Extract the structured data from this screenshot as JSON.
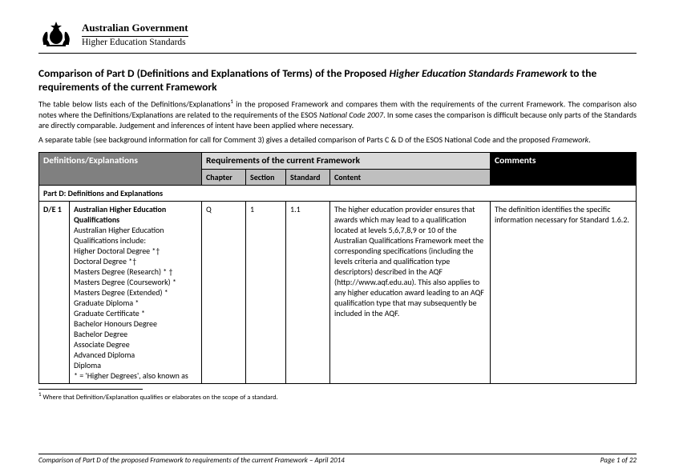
{
  "header": {
    "gov_line": "Australian Government",
    "dept_line": "Higher Education Standards"
  },
  "title": {
    "leading": "Comparison of Part D (Definitions and Explanations of Terms) of the Proposed ",
    "italic": "Higher Education Standards Framework",
    "trailing": " to the requirements of the current Framework"
  },
  "para1": {
    "a": "The table below lists each of the Definitions/Explanations",
    "sup": "1",
    "b": " in the proposed Framework and compares them with the requirements of the current Framework. The comparison also notes where the Definitions/Explanations are related to the requirements of the ESOS ",
    "ital": "National Code 2007",
    "c": ". In some cases the comparison is difficult because only parts of the Standards are directly comparable. Judgement and inferences of intent have been applied where necessary."
  },
  "para2": {
    "a": "A separate table (see background information for call for Comment 3) gives a detailed comparison of Parts C & D of the ESOS National Code and the proposed ",
    "ital": "Framework",
    "b": "."
  },
  "table": {
    "group_headers": {
      "de": "Definitions/Explanations",
      "req": "Requirements of the current Framework",
      "com": "Comments"
    },
    "sub_headers": {
      "chapter": "Chapter",
      "section": "Section",
      "standard": "Standard",
      "content": "Content"
    },
    "part_row": "Part D: Definitions and Explanations",
    "row1": {
      "code": "D/E 1",
      "desc_lead": "Australian Higher Education Qualifications",
      "desc_body": "Australian Higher Education Qualifications include:\nHigher Doctoral Degree *†\nDoctoral Degree *†\nMasters Degree (Research) * †\nMasters Degree (Coursework) *\nMasters Degree (Extended) *\nGraduate Diploma *\nGraduate Certificate *\nBachelor Honours Degree\nBachelor Degree\nAssociate Degree\nAdvanced Diploma\nDiploma\n* = 'Higher Degrees', also known as",
      "chapter": "Q",
      "section": "1",
      "standard": "1.1",
      "content": "The higher education provider ensures that awards which may lead to a qualification located at levels 5,6,7,8,9 or 10 of the Australian Qualifications Framework meet the corresponding specifications (including the levels criteria and qualification type descriptors) described in the AQF (http://www.aqf.edu.au). This also applies to any higher education award leading to an AQF qualification type that may subsequently be included in the AQF.",
      "comments": "The definition identifies the specific information necessary for Standard 1.6.2."
    }
  },
  "footnote": {
    "marker": "1",
    "text": " Where that Definition/Explanation qualifies or elaborates on the scope of a standard."
  },
  "footer": {
    "left": "Comparison of Part D of the proposed Framework to requirements of the current Framework – April 2014",
    "right": "Page 1 of 22"
  }
}
